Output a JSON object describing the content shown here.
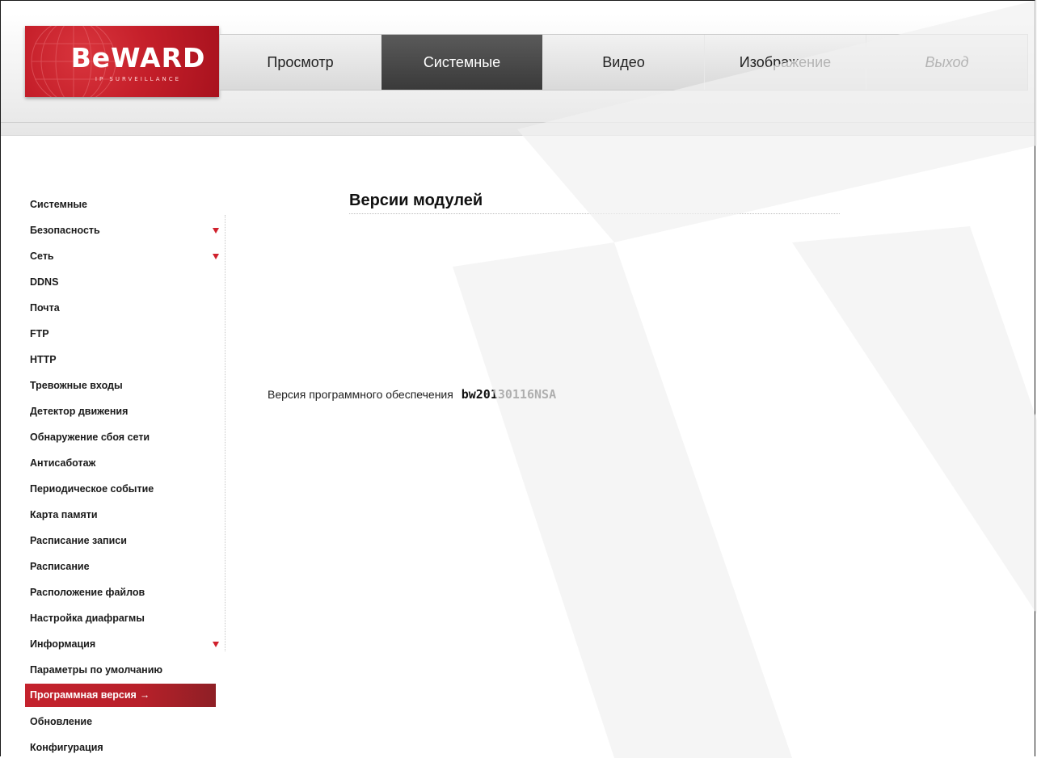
{
  "brand": {
    "logo_text": "BeWARD",
    "logo_subtext": "IP SURVEILLANCE",
    "accent_color": "#c51f2a"
  },
  "topnav": {
    "tabs": [
      {
        "label": "Просмотр",
        "active": false
      },
      {
        "label": "Системные",
        "active": true
      },
      {
        "label": "Видео",
        "active": false
      },
      {
        "label": "Изображение",
        "active": false
      },
      {
        "label": "Выход",
        "active": false
      }
    ]
  },
  "sidebar": {
    "items": [
      {
        "label": "Системные",
        "expandable": false,
        "active": false
      },
      {
        "label": "Безопасность",
        "expandable": true,
        "active": false
      },
      {
        "label": "Сеть",
        "expandable": true,
        "active": false
      },
      {
        "label": "DDNS",
        "expandable": false,
        "active": false
      },
      {
        "label": "Почта",
        "expandable": false,
        "active": false
      },
      {
        "label": "FTP",
        "expandable": false,
        "active": false
      },
      {
        "label": "HTTP",
        "expandable": false,
        "active": false
      },
      {
        "label": "Тревожные входы",
        "expandable": false,
        "active": false
      },
      {
        "label": "Детектор движения",
        "expandable": false,
        "active": false
      },
      {
        "label": "Обнаружение сбоя сети",
        "expandable": false,
        "active": false
      },
      {
        "label": "Антисаботаж",
        "expandable": false,
        "active": false
      },
      {
        "label": "Периодическое событие",
        "expandable": false,
        "active": false
      },
      {
        "label": "Карта памяти",
        "expandable": false,
        "active": false
      },
      {
        "label": "Расписание записи",
        "expandable": false,
        "active": false
      },
      {
        "label": "Расписание",
        "expandable": false,
        "active": false
      },
      {
        "label": "Расположение файлов",
        "expandable": false,
        "active": false
      },
      {
        "label": "Настройка диафрагмы",
        "expandable": false,
        "active": false
      },
      {
        "label": "Информация",
        "expandable": true,
        "active": false
      },
      {
        "label": "Параметры по умолчанию",
        "expandable": false,
        "active": false
      },
      {
        "label": "Программная версия",
        "expandable": false,
        "active": true
      },
      {
        "label": "Обновление",
        "expandable": false,
        "active": false
      },
      {
        "label": "Конфигурация",
        "expandable": false,
        "active": false
      }
    ],
    "active_arrow": "→"
  },
  "main": {
    "title": "Версии модулей",
    "firmware_label": "Версия программного обеспечения",
    "firmware_value": "bw20130116NSA"
  }
}
